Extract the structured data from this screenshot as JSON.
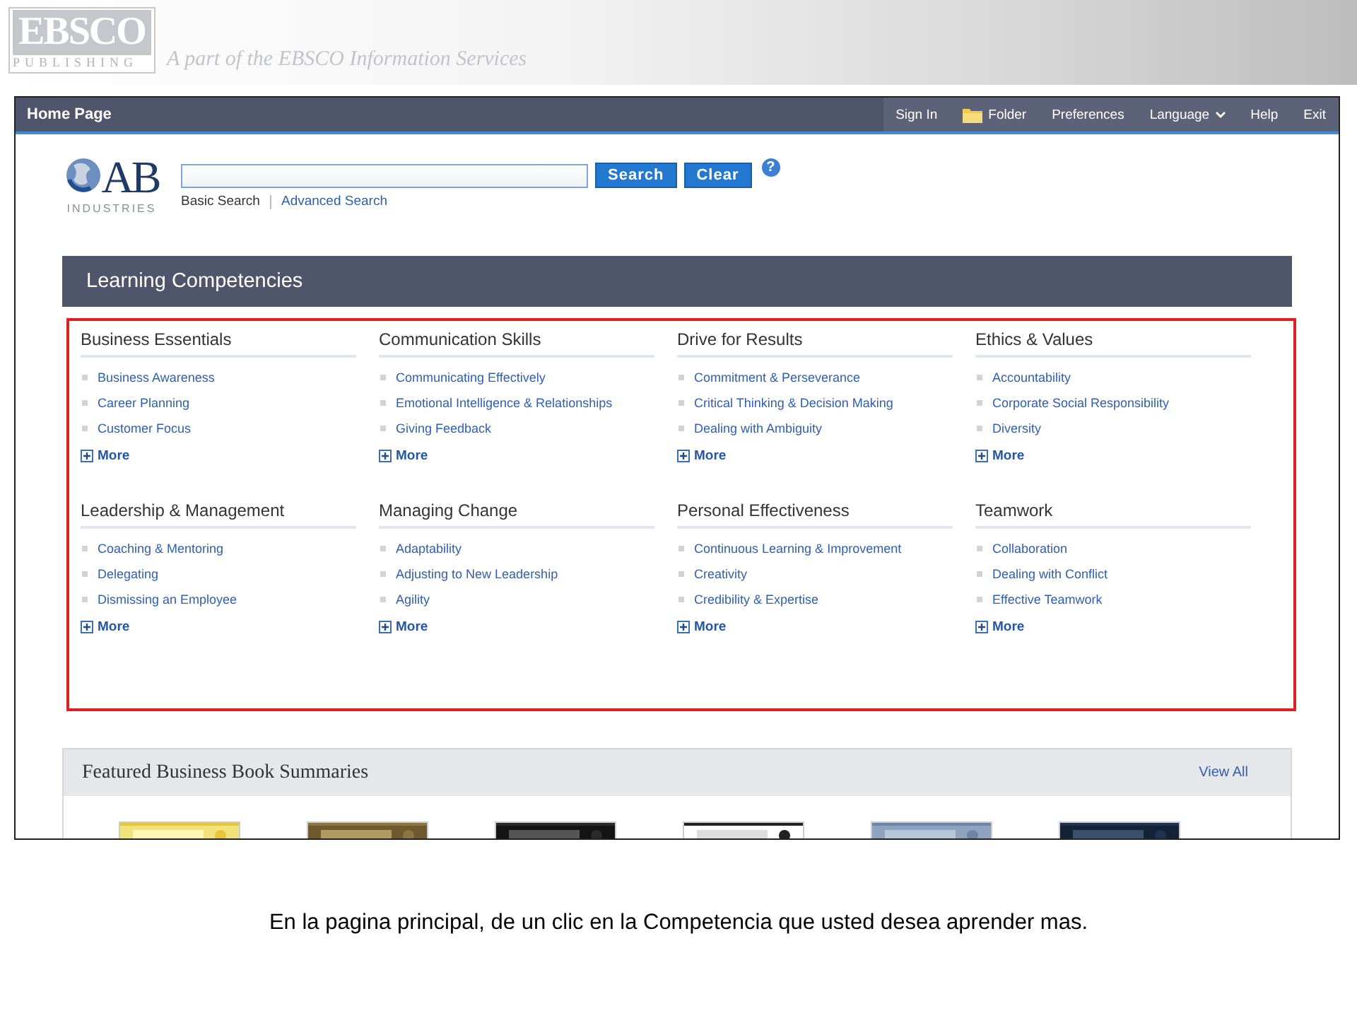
{
  "banner": {
    "logo_top": "EBSCO",
    "logo_bottom": "PUBLISHING",
    "tagline": "A part of the EBSCO Information Services"
  },
  "screen": {
    "top_bar": {
      "title": "Home Page",
      "items": [
        {
          "label": "Sign In",
          "kind": "link"
        },
        {
          "label": "Folder",
          "kind": "folder"
        },
        {
          "label": "Preferences",
          "kind": "link"
        },
        {
          "label": "Language",
          "kind": "dropdown"
        },
        {
          "label": "Help",
          "kind": "link"
        },
        {
          "label": "Exit",
          "kind": "link"
        }
      ]
    },
    "logo": {
      "mark": "AB",
      "sub": "INDUSTRIES"
    },
    "search": {
      "buttons": [
        "Search",
        "Clear"
      ],
      "help": "?",
      "modes": [
        {
          "label": "Basic Search",
          "selected": true
        },
        {
          "label": "Advanced Search",
          "selected": false
        }
      ]
    },
    "competencies": {
      "title": "Learning Competencies",
      "groups": [
        {
          "heading": "Business Essentials",
          "items": [
            "Business Awareness",
            "Career Planning",
            "Customer Focus"
          ],
          "more": "More"
        },
        {
          "heading": "Communication Skills",
          "items": [
            "Communicating Effectively",
            "Emotional Intelligence & Relationships",
            "Giving Feedback"
          ],
          "more": "More"
        },
        {
          "heading": "Drive for Results",
          "items": [
            "Commitment & Perseverance",
            "Critical Thinking & Decision Making",
            "Dealing with Ambiguity"
          ],
          "more": "More"
        },
        {
          "heading": "Ethics & Values",
          "items": [
            "Accountability",
            "Corporate Social Responsibility",
            "Diversity"
          ],
          "more": "More"
        },
        {
          "heading": "Leadership & Management",
          "items": [
            "Coaching & Mentoring",
            "Delegating",
            "Dismissing an Employee"
          ],
          "more": "More"
        },
        {
          "heading": "Managing Change",
          "items": [
            "Adaptability",
            "Adjusting to New Leadership",
            "Agility"
          ],
          "more": "More"
        },
        {
          "heading": "Personal Effectiveness",
          "items": [
            "Continuous Learning & Improvement",
            "Creativity",
            "Credibility & Expertise"
          ],
          "more": "More"
        },
        {
          "heading": "Teamwork",
          "items": [
            "Collaboration",
            "Dealing with Conflict",
            "Effective Teamwork"
          ],
          "more": "More"
        }
      ]
    },
    "featured": {
      "title": "Featured Business Book Summaries",
      "link": "View All"
    }
  },
  "caption": "En la pagina principal, de un clic en la Competencia que usted desea aprender mas."
}
